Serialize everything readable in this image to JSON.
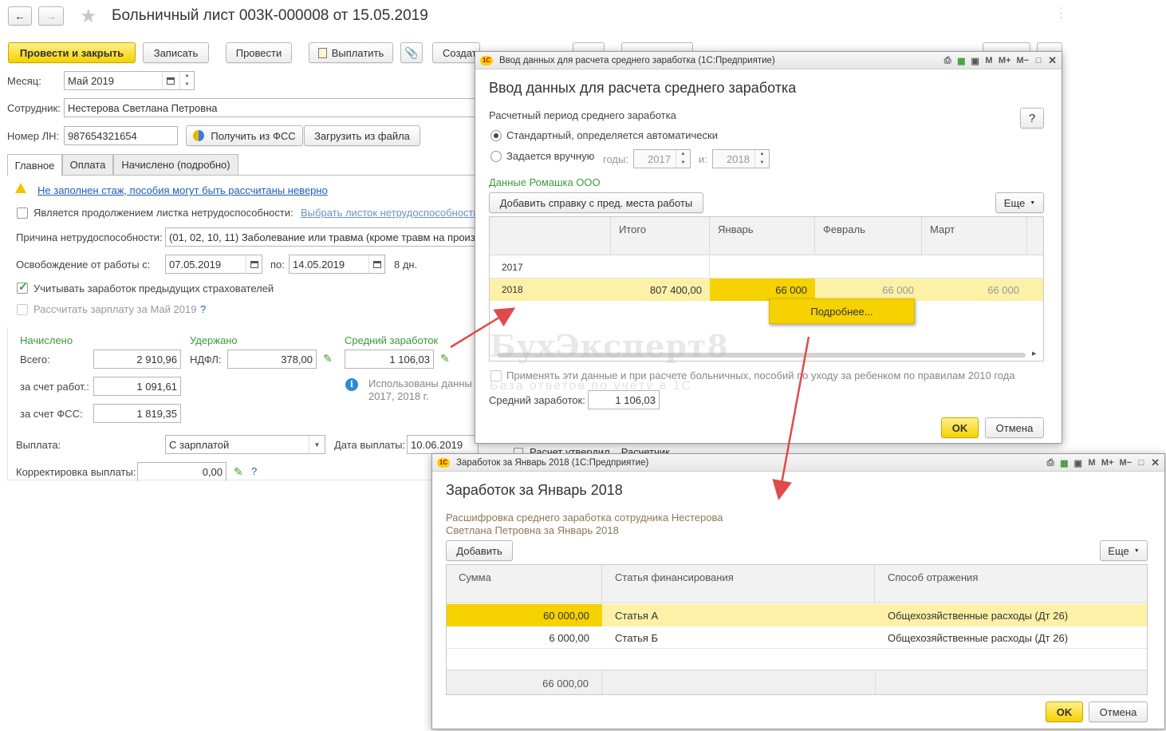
{
  "main": {
    "title": "Больничный лист 003К-000008 от 15.05.2019",
    "toolbar": {
      "post_close": "Провести и закрыть",
      "save": "Записать",
      "post": "Провести",
      "pay": "Выплатить",
      "create": "Создат"
    },
    "month_label": "Месяц:",
    "month_value": "Май 2019",
    "employee_label": "Сотрудник:",
    "employee_value": "Нестерова Светлана Петровна",
    "ln_label": "Номер ЛН:",
    "ln_value": "987654321654",
    "get_fss": "Получить из ФСС",
    "load_file": "Загрузить из файла",
    "tabs": [
      "Главное",
      "Оплата",
      "Начислено (подробно)"
    ],
    "warning_link": "Не заполнен стаж, пособия могут быть рассчитаны неверно",
    "continuation_label": "Является продолжением листка нетрудоспособности:",
    "continuation_link": "Выбрать листок нетрудоспособности",
    "reason_label": "Причина нетрудоспособности:",
    "reason_value": "(01, 02, 10, 11) Заболевание или травма (кроме травм на произв",
    "release_label": "Освобождение от работы с:",
    "release_from": "07.05.2019",
    "release_to_label": "по:",
    "release_to": "14.05.2019",
    "days": "8 дн.",
    "prev_insurers": "Учитывать заработок предыдущих страхователей",
    "recalc_salary": "Рассчитать зарплату за Май 2019",
    "qmark": "?",
    "accrued_header": "Начислено",
    "withheld_header": "Удержано",
    "avg_header": "Средний заработок",
    "total_label": "Всего:",
    "total_value": "2 910,96",
    "ndfl_label": "НДФЛ:",
    "ndfl_value": "378,00",
    "avg_value": "1 106,03",
    "employer_label": "за счет работ.:",
    "employer_value": "1 091,61",
    "fss_label": "за счет ФСС:",
    "fss_value": "1 819,35",
    "used_data": "Использованы данны",
    "used_years": "2017,   2018 г.",
    "payout_label": "Выплата:",
    "payout_value": "С зарплатой",
    "pay_date_label": "Дата выплаты:",
    "pay_date_value": "10.06.2019",
    "correction_label": "Корректировка выплаты:",
    "correction_value": "0,00",
    "calc_approved": "Расчет утвердил",
    "calculator": "Расчетчик"
  },
  "dialog1": {
    "window_title": "Ввод данных для расчета среднего заработка  (1С:Предприятие)",
    "heading": "Ввод данных для расчета среднего заработка",
    "period_label": "Расчетный период среднего заработка",
    "help": "?",
    "radio_standard": "Стандартный, определяется автоматически",
    "radio_manual": "Задается вручную",
    "years_label": "годы:",
    "year_from": "2017",
    "year_to_label": "и:",
    "year_to": "2018",
    "org_label": "Данные Ромашка ООО",
    "add_cert": "Добавить справку с пред. места работы",
    "more": "Еще",
    "columns": [
      "",
      "Итого",
      "Январь",
      "Февраль",
      "Март"
    ],
    "rows": [
      {
        "year": "2017",
        "total": "",
        "jan": "",
        "feb": "",
        "mar": ""
      },
      {
        "year": "2018",
        "total": "807 400,00",
        "jan": "66 000",
        "feb": "66 000",
        "mar": "66 000"
      }
    ],
    "popup_more": "Подробнее...",
    "apply_2010": "Применять эти данные и при расчете больничных, пособий по уходу за ребенком по правилам 2010 года",
    "avg_label": "Средний заработок:",
    "avg_value": "1 106,03",
    "ok": "OK",
    "cancel": "Отмена",
    "watermark_title": "БухЭксперт8",
    "watermark_sub": "База ответов по учёту в 1С"
  },
  "dialog2": {
    "window_title": "Заработок за Январь 2018  (1С:Предприятие)",
    "heading": "Заработок за Январь 2018",
    "description_line1": "Расшифровка среднего заработка сотрудника Нестерова",
    "description_line2": "Светлана Петровна за Январь 2018",
    "add": "Добавить",
    "more": "Еще",
    "columns": [
      "Сумма",
      "Статья финансирования",
      "Способ отражения"
    ],
    "rows": [
      {
        "sum": "60 000,00",
        "article": "Статья А",
        "method": "Общехозяйственные расходы (Дт 26)"
      },
      {
        "sum": "6 000,00",
        "article": "Статья Б",
        "method": "Общехозяйственные расходы (Дт 26)"
      }
    ],
    "footer_sum": "66 000,00",
    "ok": "OK",
    "cancel": "Отмена"
  },
  "colors": {
    "accent_yellow": "#f5d200",
    "row_highlight": "#fdf1a8",
    "green_label": "#3a9b3a",
    "link_blue": "#1b5fb5",
    "arrow_red": "#e04a4a"
  }
}
